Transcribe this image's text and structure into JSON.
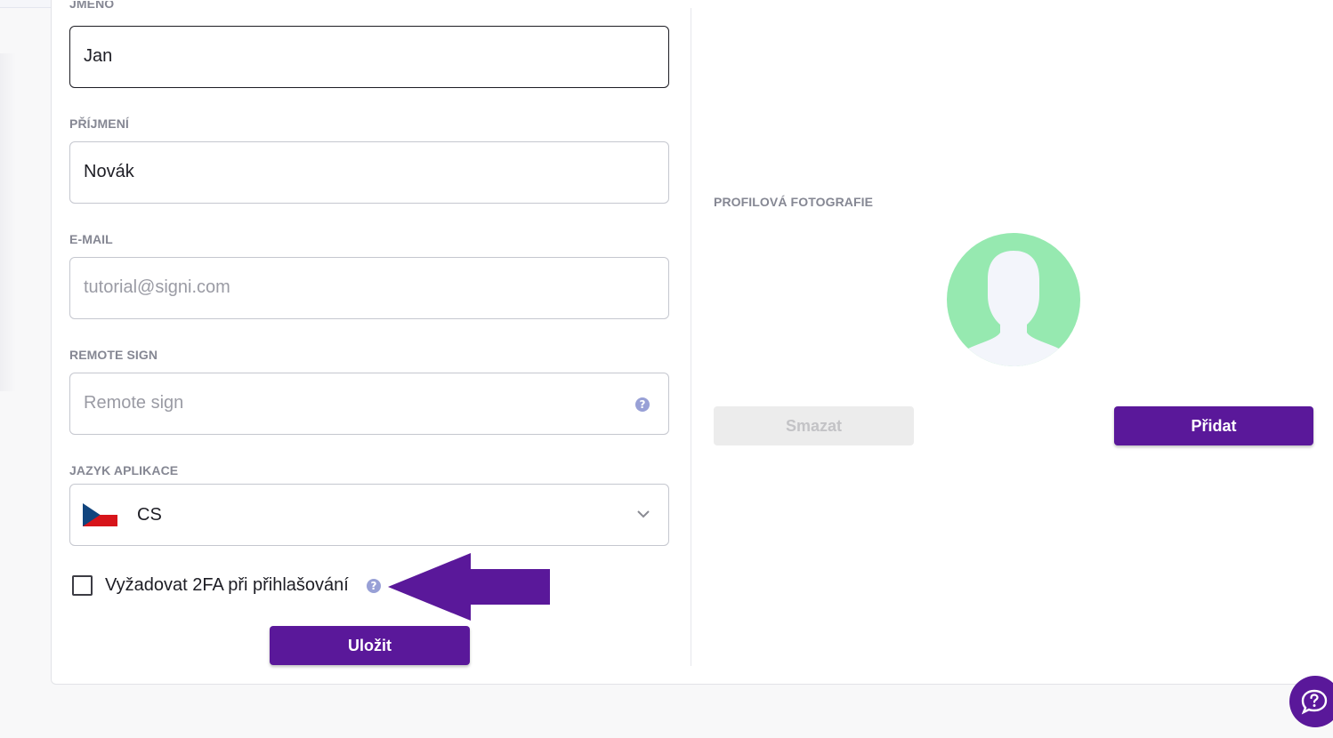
{
  "form": {
    "first_name": {
      "label": "JMÉNO",
      "value": "Jan"
    },
    "last_name": {
      "label": "PŘÍJMENÍ",
      "value": "Novák"
    },
    "email": {
      "label": "E-MAIL",
      "placeholder": "tutorial@signi.com"
    },
    "remote_sign": {
      "label": "REMOTE SIGN",
      "placeholder": "Remote sign",
      "help_icon": "?"
    },
    "language": {
      "label": "JAZYK APLIKACE",
      "value": "CS",
      "flag_icon": "czech-flag-icon"
    },
    "require_2fa": {
      "label": "Vyžadovat 2FA při přihlašování",
      "checked": false,
      "help_icon": "?"
    },
    "save_label": "Uložit"
  },
  "profile_photo": {
    "label": "PROFILOVÁ FOTOGRAFIE",
    "delete_label": "Smazat",
    "add_label": "Přidat"
  },
  "colors": {
    "accent": "#5a189a",
    "avatar_bg": "#96e9b0",
    "help_icon": "#98a0d6"
  }
}
